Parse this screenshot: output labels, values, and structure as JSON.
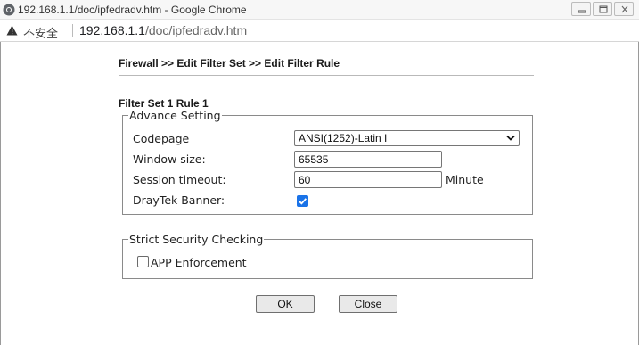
{
  "window": {
    "title": "192.168.1.1/doc/ipfedradv.htm - Google Chrome",
    "insecure_label": "不安全",
    "url_host": "192.168.1.1",
    "url_path": "/doc/ipfedradv.htm"
  },
  "page": {
    "breadcrumb": "Firewall >> Edit Filter Set >> Edit Filter Rule",
    "set_title": "Filter Set 1 Rule 1"
  },
  "advance": {
    "legend": "Advance Setting",
    "codepage_label": "Codepage",
    "codepage_value": "ANSI(1252)-Latin I",
    "window_label": "Window size:",
    "window_value": "65535",
    "session_label": "Session timeout:",
    "session_value": "60",
    "session_unit": "Minute",
    "banner_label": "DrayTek Banner:",
    "banner_checked": true
  },
  "security": {
    "legend": "Strict Security Checking",
    "app_label": "APP Enforcement",
    "app_checked": false
  },
  "buttons": {
    "ok": "OK",
    "close": "Close"
  },
  "icons": {
    "tab": "chrome-page-icon",
    "warning": "warning-triangle-icon",
    "minimize": "minimize-icon",
    "maximize": "maximize-icon",
    "close": "close-icon",
    "dropdown": "chevron-down-icon",
    "check": "checkmark-icon"
  },
  "colors": {
    "checkbox_accent": "#1a73e8"
  }
}
